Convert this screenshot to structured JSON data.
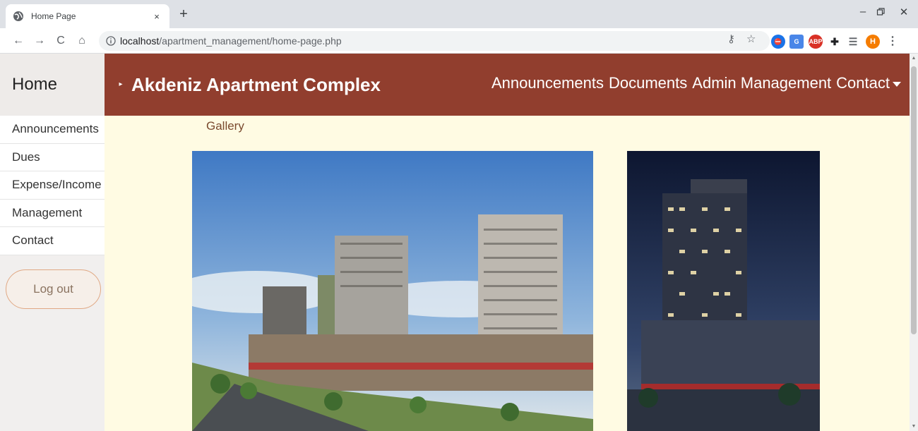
{
  "browser": {
    "tab_title": "Home Page",
    "tab_close": "×",
    "new_tab": "+",
    "url_host": "localhost",
    "url_path": "/apartment_management/home-page.php",
    "profile_initial": "H",
    "abp_label": "ABP"
  },
  "sidebar": {
    "title": "Home",
    "items": [
      {
        "label": "Announcements"
      },
      {
        "label": "Dues"
      },
      {
        "label": "Expense/Income"
      },
      {
        "label": "Management"
      },
      {
        "label": "Contact"
      }
    ],
    "logout_label": "Log out"
  },
  "header": {
    "brand": "Akdeniz Apartment Complex",
    "nav": [
      {
        "label": "Announcements"
      },
      {
        "label": "Documents"
      },
      {
        "label": "Admin Management"
      },
      {
        "label": "Contact"
      }
    ]
  },
  "main": {
    "gallery_title": "Gallery"
  },
  "colors": {
    "header_bg": "#913e2e",
    "page_bg": "#fffbe3",
    "sidebar_bg": "#f1efee",
    "logout_border": "#e0a884"
  }
}
